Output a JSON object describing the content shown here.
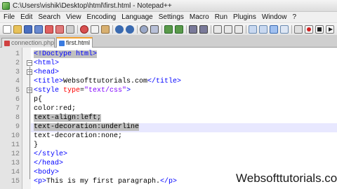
{
  "window": {
    "title": "C:\\Users\\vishik\\Desktop\\html\\first.html - Notepad++"
  },
  "menu": [
    "File",
    "Edit",
    "Search",
    "View",
    "Encoding",
    "Language",
    "Settings",
    "Macro",
    "Run",
    "Plugins",
    "Window",
    "?"
  ],
  "tabs": [
    {
      "label": "connection.php",
      "active": false,
      "icon_color": "#d04040"
    },
    {
      "label": "first.html",
      "active": true,
      "icon_color": "#3a7be0"
    }
  ],
  "toolbar_icons": [
    "new-file-icon",
    "open-file-icon",
    "save-icon",
    "save-all-icon",
    "close-icon",
    "close-all-icon",
    "print-icon",
    "cut-icon",
    "copy-icon",
    "paste-icon",
    "undo-icon",
    "redo-icon",
    "find-icon",
    "replace-icon",
    "zoom-in-icon",
    "zoom-out-icon",
    "sync-vertical-icon",
    "sync-horizontal-icon",
    "word-wrap-icon",
    "show-all-chars-icon",
    "indent-guide-icon",
    "lang-icon",
    "record-macro-icon",
    "stop-macro-icon",
    "play-macro-icon"
  ],
  "editor": {
    "line_numbers": [
      "1",
      "2",
      "3",
      "4",
      "5",
      "6",
      "7",
      "8",
      "9",
      "10",
      "11",
      "12",
      "13",
      "14",
      "15"
    ],
    "lines": [
      [
        {
          "t": "<!Doctype html>",
          "c": "doc",
          "sel": true
        }
      ],
      [
        {
          "t": "<html>",
          "c": "tag"
        }
      ],
      [
        {
          "t": "<head>",
          "c": "tag"
        }
      ],
      [
        {
          "t": "<title>",
          "c": "tag"
        },
        {
          "t": "Websofttutorials.com",
          "c": ""
        },
        {
          "t": "</title>",
          "c": "tag"
        }
      ],
      [
        {
          "t": "<style ",
          "c": "tag"
        },
        {
          "t": "type",
          "c": "attr"
        },
        {
          "t": "=",
          "c": ""
        },
        {
          "t": "\"text/css\"",
          "c": "val"
        },
        {
          "t": ">",
          "c": "tag"
        }
      ],
      [
        {
          "t": "p{",
          "c": ""
        }
      ],
      [
        {
          "t": "color:red;",
          "c": ""
        }
      ],
      [
        {
          "t": "text-align:left;",
          "c": "",
          "sel": true
        }
      ],
      [
        {
          "t": "text-decoration:underline",
          "c": "",
          "sel": true
        }
      ],
      [
        {
          "t": "text-decoration:none;",
          "c": ""
        }
      ],
      [
        {
          "t": "}",
          "c": ""
        }
      ],
      [
        {
          "t": "</style>",
          "c": "tag"
        }
      ],
      [
        {
          "t": "</head>",
          "c": "tag"
        }
      ],
      [
        {
          "t": "<body>",
          "c": "tag"
        }
      ],
      [
        {
          "t": "<p>",
          "c": "tag"
        },
        {
          "t": "This is my first paragraph.",
          "c": ""
        },
        {
          "t": "</p>",
          "c": "tag"
        }
      ]
    ]
  },
  "watermark": "Websofttutorials.com",
  "colors": {
    "tag": "#0000ff",
    "attribute": "#ff0000",
    "value": "#8000ff",
    "selection": "#c0c0c0",
    "active_tab_accent": "#f0a030"
  }
}
